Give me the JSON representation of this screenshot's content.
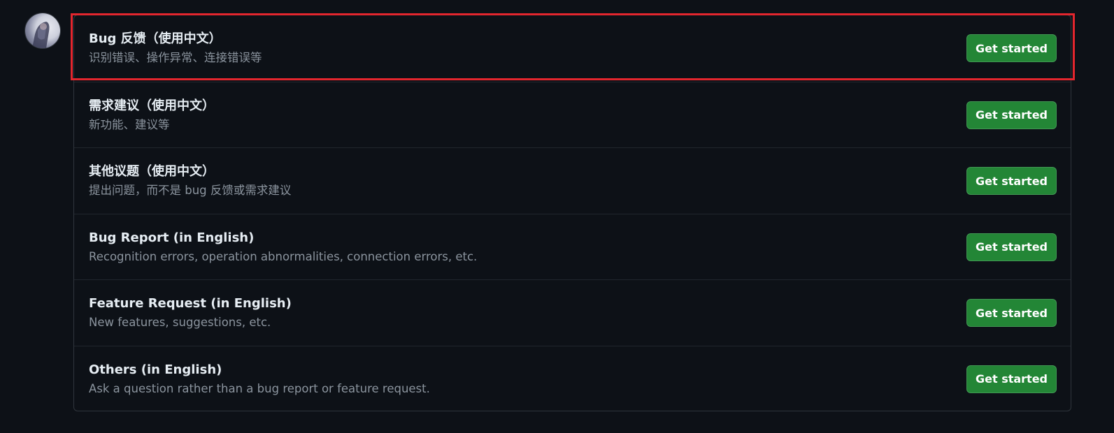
{
  "highlight_color": "#e3262e",
  "button_color": "#238636",
  "avatar": {
    "icon": "user-avatar"
  },
  "templates": [
    {
      "title": "Bug 反馈（使用中文）",
      "description": "识别错误、操作异常、连接错误等",
      "button_label": "Get started",
      "highlighted": true
    },
    {
      "title": "需求建议（使用中文）",
      "description": "新功能、建议等",
      "button_label": "Get started"
    },
    {
      "title": "其他议题（使用中文）",
      "description": "提出问题，而不是 bug 反馈或需求建议",
      "button_label": "Get started"
    },
    {
      "title": "Bug Report (in English)",
      "description": "Recognition errors, operation abnormalities, connection errors, etc.",
      "button_label": "Get started"
    },
    {
      "title": "Feature Request (in English)",
      "description": "New features, suggestions, etc.",
      "button_label": "Get started"
    },
    {
      "title": "Others (in English)",
      "description": "Ask a question rather than a bug report or feature request.",
      "button_label": "Get started"
    }
  ]
}
